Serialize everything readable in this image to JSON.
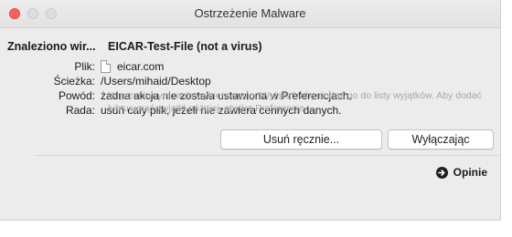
{
  "window": {
    "title": "Ostrzeżenie Malware"
  },
  "header": {
    "found_label": "Znaleziono wir...",
    "threat_name": "EICAR-Test-File (not a virus)"
  },
  "details": [
    {
      "key": "Plik:",
      "value": "eicar.com"
    },
    {
      "key": "Ścieżka:",
      "value": "/Users/mihaid/Desktop"
    },
    {
      "key": "Powód:",
      "value": "żadna akcja nie została ustawiona w Preferencjach."
    },
    {
      "key": "Rada:",
      "value": "usuń cały plik, jeżeli nie zawiera cennych danych."
    }
  ],
  "note": "W przeciwnym razie wybierz opcję \"Wyłącz\", aby dodać go do listy wyjątków. Aby dodać lub usunąć wyjątki później, otwórz Preferencje.",
  "buttons": {
    "manual_remove": "Usuń ręcznie...",
    "disable": "Wyłączając"
  },
  "footer": {
    "opinions": "Opinie"
  }
}
